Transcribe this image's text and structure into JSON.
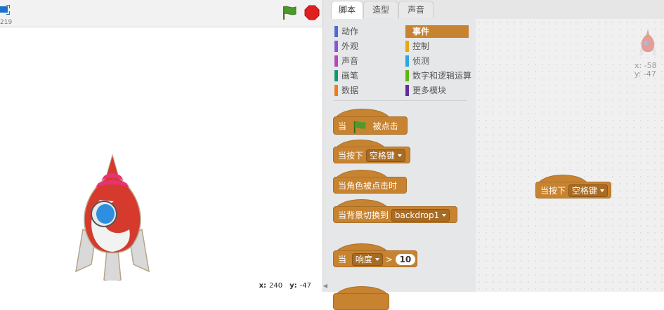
{
  "stage": {
    "version": "219",
    "mouse_x_label": "x:",
    "mouse_x": "240",
    "mouse_y_label": "y:",
    "mouse_y": "-47"
  },
  "tabs": [
    "脚本",
    "造型",
    "声音"
  ],
  "categories_left": [
    {
      "label": "动作",
      "color": "#4a6cd4"
    },
    {
      "label": "外观",
      "color": "#8a55d7"
    },
    {
      "label": "声音",
      "color": "#bb42c3"
    },
    {
      "label": "画笔",
      "color": "#0e9a6c"
    },
    {
      "label": "数据",
      "color": "#ee7d16"
    }
  ],
  "categories_right": [
    {
      "label": "事件",
      "color": "#c88330",
      "selected": true
    },
    {
      "label": "控制",
      "color": "#e1a91a"
    },
    {
      "label": "侦测",
      "color": "#2ca5e2"
    },
    {
      "label": "数字和逻辑运算",
      "color": "#5cb712"
    },
    {
      "label": "更多模块",
      "color": "#632d99"
    }
  ],
  "blocks": {
    "flag_pre": "当",
    "flag_post": "被点击",
    "key_pre": "当按下",
    "key_value": "空格键",
    "sprite_clicked": "当角色被点击时",
    "backdrop_pre": "当背景切换到",
    "backdrop_value": "backdrop1",
    "loud_pre": "当",
    "loud_value": "响度",
    "loud_op": ">",
    "loud_num": "10"
  },
  "scripts_area": {
    "sprite_x": "x: -58",
    "sprite_y": "y: -47",
    "block_pre": "当按下",
    "block_value": "空格键"
  },
  "colors": {
    "events": "#c88330",
    "green_flag": "#4c9a2a",
    "stop": "#e02020"
  }
}
